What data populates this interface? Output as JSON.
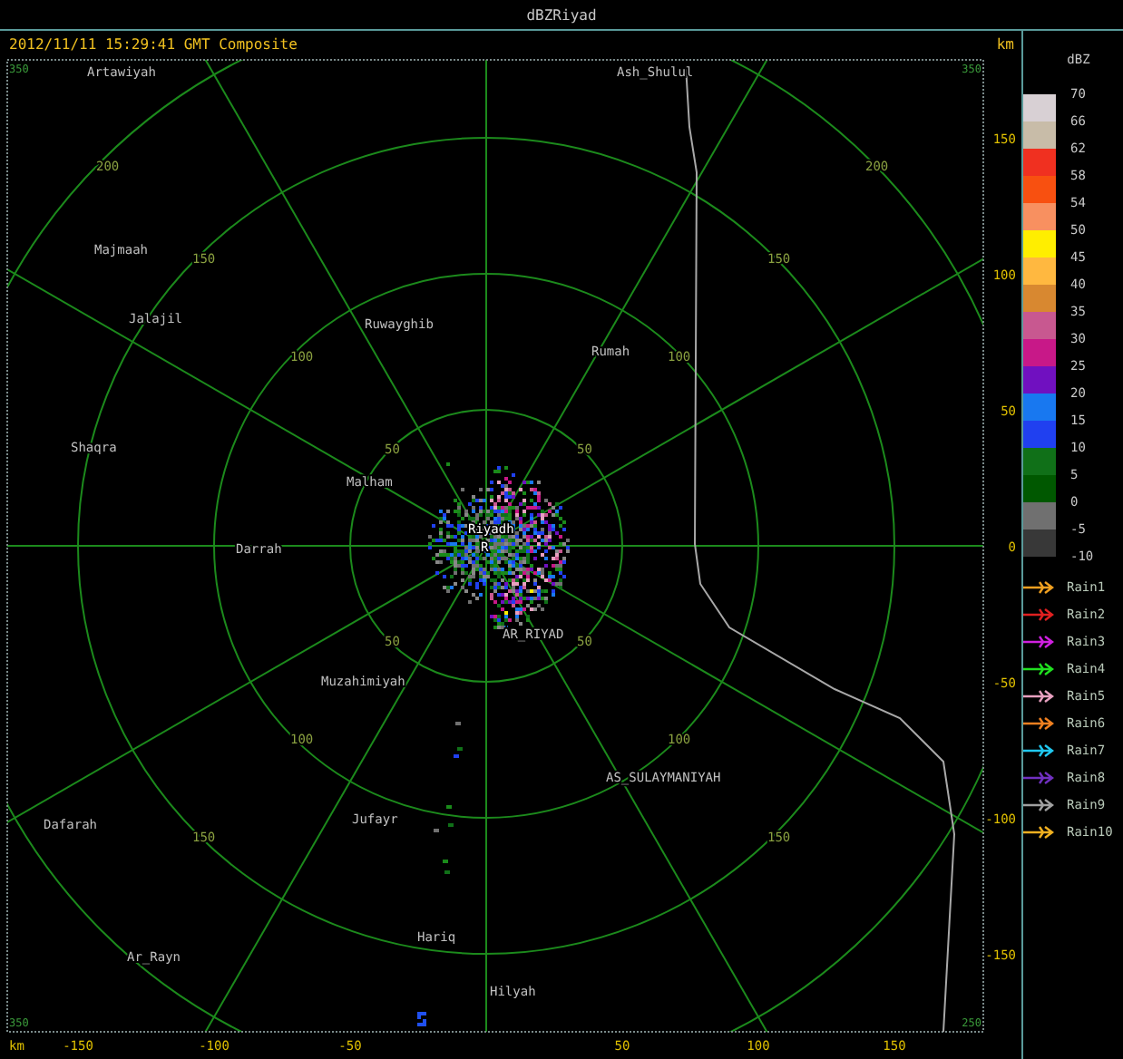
{
  "window": {
    "title": "dBZRiyad"
  },
  "map": {
    "caption": "2012/11/11 15:29:41 GMT Composite",
    "unit_top": "km",
    "unit_bottom": "km",
    "corner_labels": [
      "350",
      "350",
      "350",
      "250"
    ],
    "places": [
      "Artawiyah",
      "Ash_Shulul",
      "Majmaah",
      "Jalajil",
      "Ruwayghib",
      "Rumah",
      "Shaqra",
      "Malham",
      "Riyadh",
      "R",
      "Darrah",
      "AR_RIYAD",
      "Muzahimiyah",
      "AS_SULAYMANIYAH",
      "Dafarah",
      "Jufayr",
      "Hariq",
      "Ar_Rayn",
      "Hilyah"
    ],
    "range_labels": [
      "50",
      "100",
      "150",
      "200",
      "50",
      "100",
      "150",
      "200",
      "50",
      "100",
      "150",
      "50",
      "100",
      "150"
    ],
    "x_ticks": [
      "-150",
      "-100",
      "-50",
      "50",
      "100",
      "150"
    ],
    "y_ticks": [
      "150",
      "100",
      "50",
      "0",
      "-50",
      "-100",
      "-150"
    ]
  },
  "legend": {
    "title": "dBZ",
    "scale": [
      {
        "label": "70",
        "color": "#d8d0d4"
      },
      {
        "label": "66",
        "color": "#c8bca8"
      },
      {
        "label": "62",
        "color": "#f03020"
      },
      {
        "label": "58",
        "color": "#f85010"
      },
      {
        "label": "54",
        "color": "#f89060"
      },
      {
        "label": "50",
        "color": "#ffee00"
      },
      {
        "label": "45",
        "color": "#ffb840"
      },
      {
        "label": "40",
        "color": "#d88830"
      },
      {
        "label": "35",
        "color": "#c85890"
      },
      {
        "label": "30",
        "color": "#c81888"
      },
      {
        "label": "25",
        "color": "#7010c0"
      },
      {
        "label": "20",
        "color": "#1878f0"
      },
      {
        "label": "15",
        "color": "#2040f0"
      },
      {
        "label": "10",
        "color": "#107018"
      },
      {
        "label": "5",
        "color": "#005800"
      },
      {
        "label": "0",
        "color": "#707070"
      },
      {
        "label": "-5",
        "color": "#383838"
      }
    ],
    "bottom_label": "-10",
    "tracks": [
      {
        "label": "Rain1",
        "color": "#f0a020"
      },
      {
        "label": "Rain2",
        "color": "#e02020"
      },
      {
        "label": "Rain3",
        "color": "#d020e0"
      },
      {
        "label": "Rain4",
        "color": "#20e020"
      },
      {
        "label": "Rain5",
        "color": "#e8a0c0"
      },
      {
        "label": "Rain6",
        "color": "#f08020"
      },
      {
        "label": "Rain7",
        "color": "#20c8f0"
      },
      {
        "label": "Rain8",
        "color": "#7030c0"
      },
      {
        "label": "Rain9",
        "color": "#a0a0a0"
      },
      {
        "label": "Rain10",
        "color": "#f0b020"
      }
    ]
  }
}
